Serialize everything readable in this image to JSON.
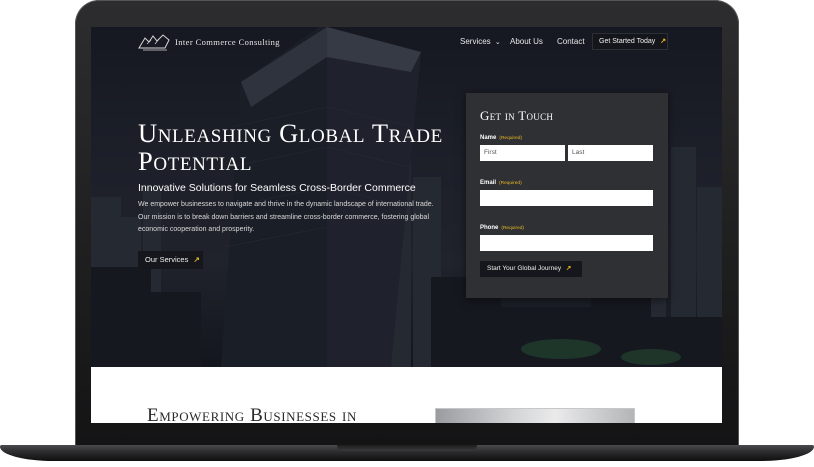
{
  "nav": {
    "brand": "Inter Commerce Consulting",
    "links": [
      "Services",
      "About Us",
      "Contact"
    ],
    "services_caret": "⌄",
    "cta_label": "Get Started Today",
    "arrow_glyph": "↗"
  },
  "hero": {
    "title": "Unleashing Global Trade Potential",
    "subtitle": "Innovative Solutions for Seamless Cross-Border Commerce",
    "description": "We empower businesses to navigate and thrive in the dynamic landscape of international trade. Our mission is to break down barriers and streamline cross-border commerce, fostering global economic cooperation and prosperity.",
    "button_label": "Our Services"
  },
  "form": {
    "title": "Get in Touch",
    "required_text": "(Required)",
    "name_label": "Name",
    "first_placeholder": "First",
    "last_placeholder": "Last",
    "email_label": "Email",
    "phone_label": "Phone",
    "submit_label": "Start Your Global Journey"
  },
  "section": {
    "heading": "Empowering Businesses in"
  },
  "colors": {
    "accent": "#e8b923",
    "button_bg": "#16171c",
    "form_bg": "#2f3033"
  },
  "icons": [
    "griffin-logo-icon",
    "chevron-down-icon",
    "arrow-up-right-icon"
  ]
}
